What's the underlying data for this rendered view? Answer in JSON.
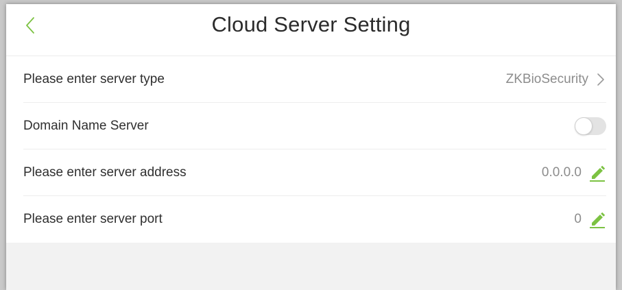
{
  "header": {
    "title": "Cloud Server Setting",
    "back_icon": "chevron-left-icon"
  },
  "settings": [
    {
      "label": "Please enter server type",
      "value": "ZKBioSecurity",
      "control": "chevron-right-icon"
    },
    {
      "label": "Domain Name Server",
      "toggle_on": false
    },
    {
      "label": "Please enter server address",
      "value": "0.0.0.0",
      "control": "pencil-icon"
    },
    {
      "label": "Please enter server port",
      "value": "0",
      "control": "pencil-icon"
    }
  ],
  "colors": {
    "accent": "#7cc242",
    "label": "#2f2f2f",
    "value": "#8c8c8c",
    "background": "#f2f2f2"
  }
}
